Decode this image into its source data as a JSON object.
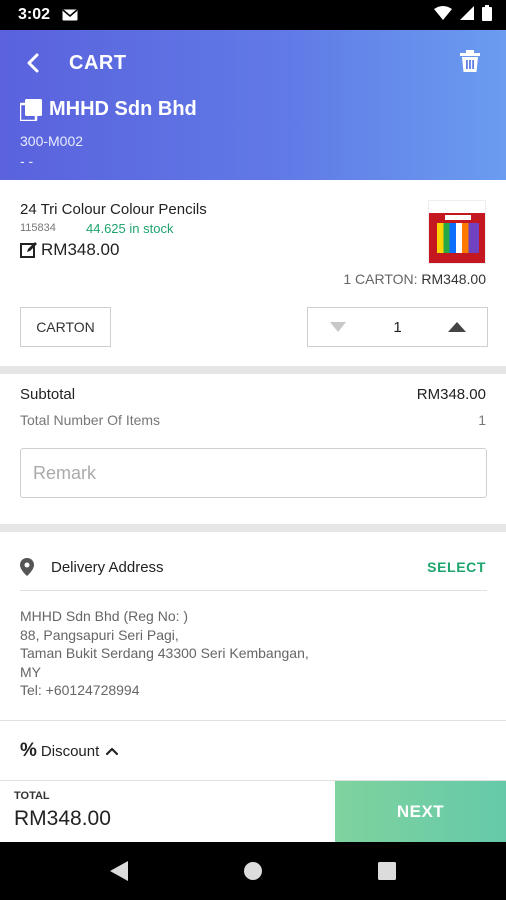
{
  "status_bar": {
    "time": "3:02"
  },
  "header": {
    "title": "CART",
    "company_name": "MHHD Sdn Bhd",
    "company_code": "300-M002",
    "company_sub": "- -"
  },
  "product": {
    "name": "24 Tri Colour Colour Pencils",
    "code": "115834",
    "stock": "44.625 in stock",
    "price": "RM348.00",
    "line_summary_prefix": "1 CARTON:",
    "line_summary_amount": "RM348.00",
    "uom": "CARTON",
    "quantity": "1"
  },
  "summary": {
    "subtotal_label": "Subtotal",
    "subtotal_value": "RM348.00",
    "items_label": "Total Number Of Items",
    "items_value": "1",
    "remark_placeholder": "Remark"
  },
  "delivery": {
    "label": "Delivery Address",
    "select_label": "SELECT",
    "address_lines": [
      "MHHD Sdn Bhd (Reg No: )",
      "88, Pangsapuri Seri Pagi,",
      "Taman Bukit Serdang 43300 Seri Kembangan,",
      "MY",
      "Tel: +60124728994"
    ]
  },
  "discount": {
    "label": "Discount"
  },
  "footer": {
    "total_label": "TOTAL",
    "total_value": "RM348.00",
    "next_label": "NEXT"
  },
  "colors": {
    "header_start": "#5a62dd",
    "header_end": "#6a9cf0",
    "stock_green": "#1ea46c",
    "next_button": "#7fd39e"
  },
  "icons": [
    "back-arrow-icon",
    "trash-icon",
    "copy-icon",
    "edit-icon",
    "pin-icon",
    "percent-icon",
    "chevron-up-icon",
    "back-triangle-icon",
    "home-circle-icon",
    "recents-square-icon"
  ]
}
